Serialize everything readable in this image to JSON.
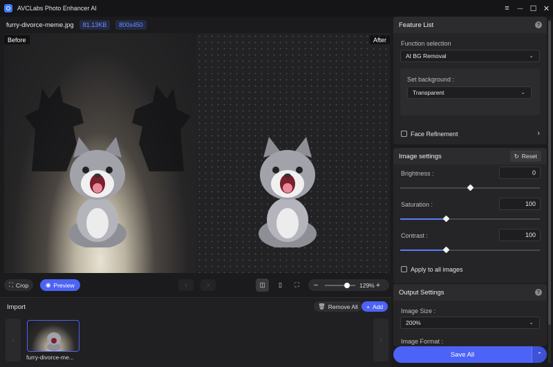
{
  "titlebar": {
    "app_title": "AVCLabs Photo Enhancer AI",
    "menu_icon": "≡",
    "minimize_icon": "—",
    "maximize_icon": "☐",
    "close_icon": "✕"
  },
  "file": {
    "name": "furry-divorce-meme.jpg",
    "size": "81.13KB",
    "dimensions": "800x450"
  },
  "canvas": {
    "before_label": "Before",
    "after_label": "After"
  },
  "toolbar": {
    "crop_label": "Crop",
    "preview_label": "Preview",
    "prev_icon": "‹",
    "next_icon": "›",
    "zoom_value": "129%",
    "zoom_level_fraction": 0.73
  },
  "import": {
    "title": "Import",
    "remove_all_label": "Remove All",
    "add_label": "Add",
    "strip_prev_icon": "‹",
    "strip_next_icon": "›",
    "thumb_caption": "furry-divorce-me..."
  },
  "feature_list": {
    "title": "Feature List",
    "function_label": "Function selection",
    "function_value": "AI BG Removal",
    "background_label": "Set background :",
    "background_value": "Transparent",
    "face_refinement_label": "Face Refinement",
    "face_refinement_checked": false
  },
  "image_settings": {
    "title": "Image settings",
    "reset_label": "Reset",
    "brightness_label": "Brightness :",
    "brightness_value": "0",
    "brightness_fraction": 0.5,
    "saturation_label": "Saturation :",
    "saturation_value": "100",
    "saturation_fraction": 0.33,
    "contrast_label": "Contrast :",
    "contrast_value": "100",
    "contrast_fraction": 0.33,
    "apply_all_label": "Apply to all images"
  },
  "output_settings": {
    "title": "Output Settings",
    "size_label": "Image Size :",
    "size_value": "200%",
    "format_label": "Image Format :",
    "save_all_label": "Save All",
    "save_menu_icon": "⌃"
  },
  "colors": {
    "accent": "#4c63f5",
    "panel": "#252527",
    "background": "#1b1b1d"
  }
}
